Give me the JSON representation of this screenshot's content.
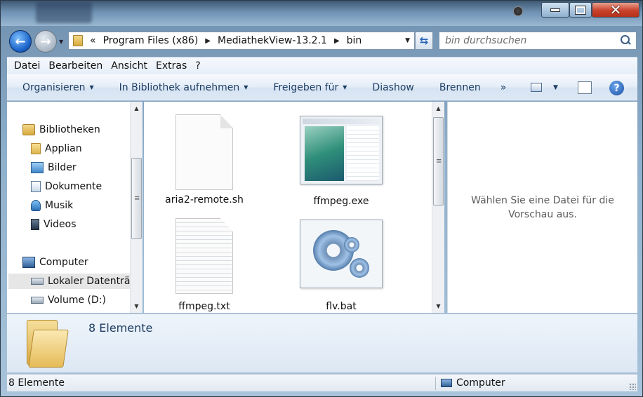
{
  "window": {
    "title": ""
  },
  "nav": {
    "breadcrumbs": [
      "Program Files (x86)",
      "MediathekView-13.2.1",
      "bin"
    ],
    "overflow": "«",
    "search_placeholder": "bin durchsuchen"
  },
  "menu": [
    "Datei",
    "Bearbeiten",
    "Ansicht",
    "Extras",
    "?"
  ],
  "toolbar": {
    "organize": "Organisieren",
    "library": "In Bibliothek aufnehmen",
    "share": "Freigeben für",
    "slideshow": "Diashow",
    "burn": "Brennen",
    "more": "»"
  },
  "navpane": {
    "libraries": "Bibliotheken",
    "items": [
      "Applian",
      "Bilder",
      "Dokumente",
      "Musik",
      "Videos"
    ],
    "computer": "Computer",
    "drives": [
      "Lokaler Datenträger (C:)",
      "Volume (D:)"
    ]
  },
  "files": [
    {
      "name": "aria2-remote.sh",
      "icon": "blank-document-icon"
    },
    {
      "name": "ffmpeg.exe",
      "icon": "application-window-icon"
    },
    {
      "name": "ffmpeg.txt",
      "icon": "text-document-icon"
    },
    {
      "name": "flv.bat",
      "icon": "batch-gears-icon"
    }
  ],
  "preview": {
    "message": "Wählen Sie eine Datei für die Vorschau aus."
  },
  "details": {
    "count": "8 Elemente"
  },
  "status": {
    "left": "8 Elemente",
    "right": "Computer"
  }
}
